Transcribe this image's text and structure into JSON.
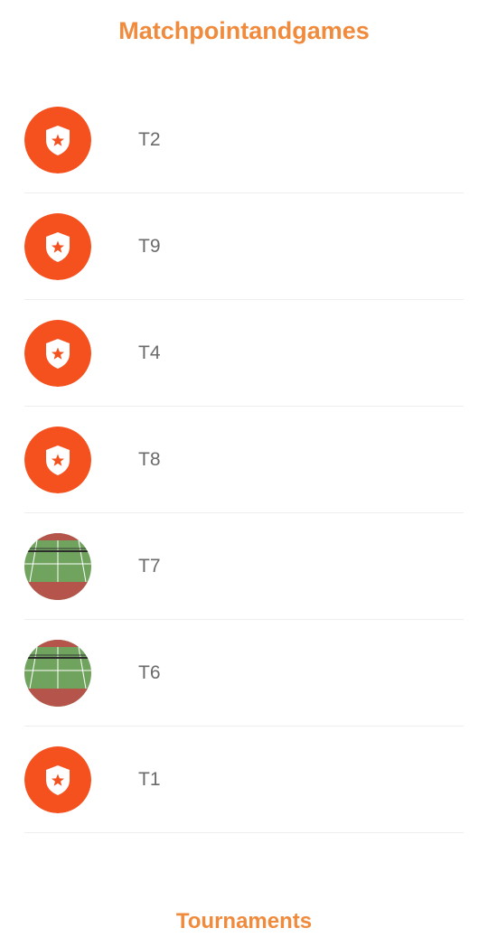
{
  "header": {
    "title": "Matchpointandgames"
  },
  "theme": {
    "accent": "#F08A3C",
    "badge": "#F4511E",
    "court_green": "#6FA35E",
    "court_clay": "#B5544A"
  },
  "tournaments": [
    {
      "label": "T2",
      "icon": "shield-star-icon"
    },
    {
      "label": "T9",
      "icon": "shield-star-icon"
    },
    {
      "label": "T4",
      "icon": "shield-star-icon"
    },
    {
      "label": "T8",
      "icon": "shield-star-icon"
    },
    {
      "label": "T7",
      "icon": "tennis-court-icon"
    },
    {
      "label": "T6",
      "icon": "tennis-court-icon"
    },
    {
      "label": "T1",
      "icon": "shield-star-icon"
    }
  ],
  "footer": {
    "tab_label": "Tournaments"
  }
}
